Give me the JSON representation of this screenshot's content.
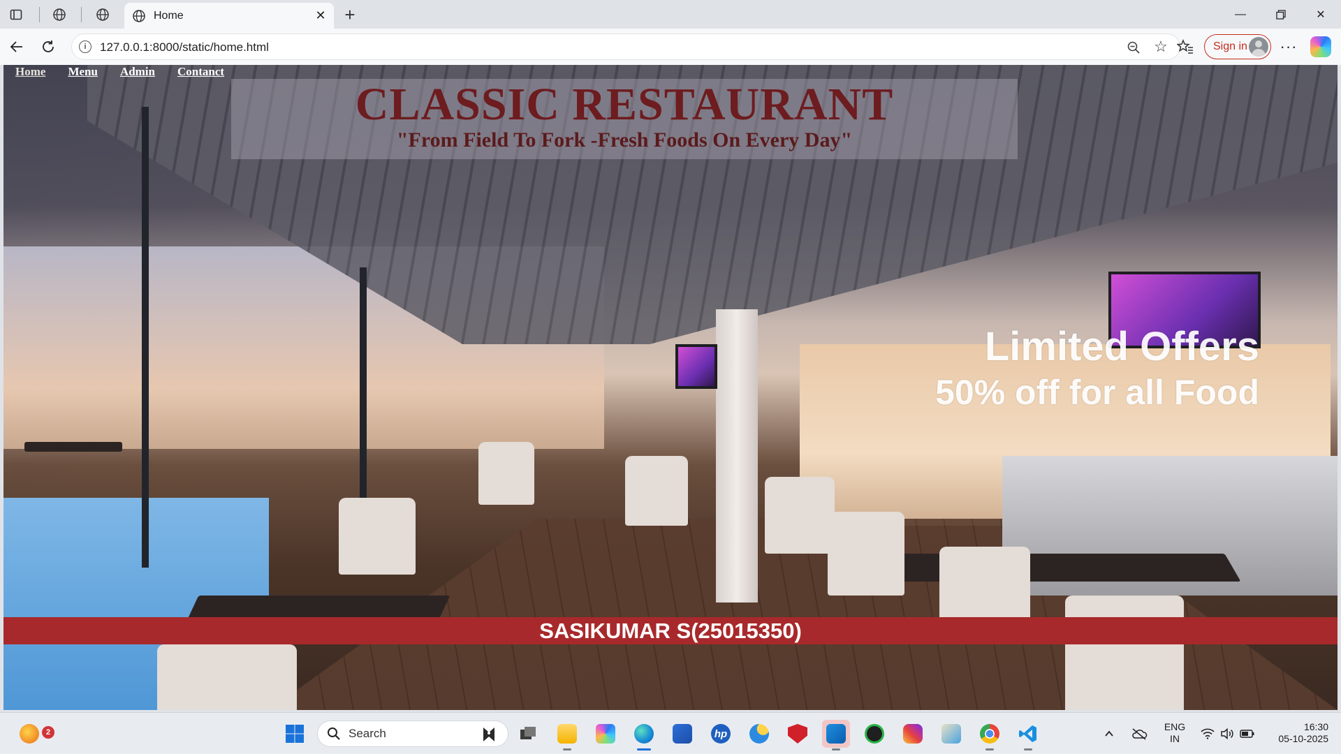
{
  "browser": {
    "tab_title": "Home",
    "url": "127.0.0.1:8000/static/home.html",
    "signin_label": "Sign in"
  },
  "page": {
    "nav": [
      "Home",
      "Menu",
      "Admin",
      "Contanct"
    ],
    "title": "CLASSIC RESTAURANT",
    "tagline": "\"From Field To Fork -Fresh Foods On Every Day\"",
    "offer_line1": "Limited Offers",
    "offer_line2": "50% off for all Food",
    "footer": "SASIKUMAR S(25015350)"
  },
  "taskbar": {
    "search_label": "Search",
    "notification_count": "2",
    "lang_primary": "ENG",
    "lang_secondary": "IN",
    "time": "16:30",
    "date": "05-10-2025"
  },
  "colors": {
    "title": "#6d1c1f",
    "footer_bg": "#a8292b",
    "signin_accent": "#c42b1c"
  }
}
